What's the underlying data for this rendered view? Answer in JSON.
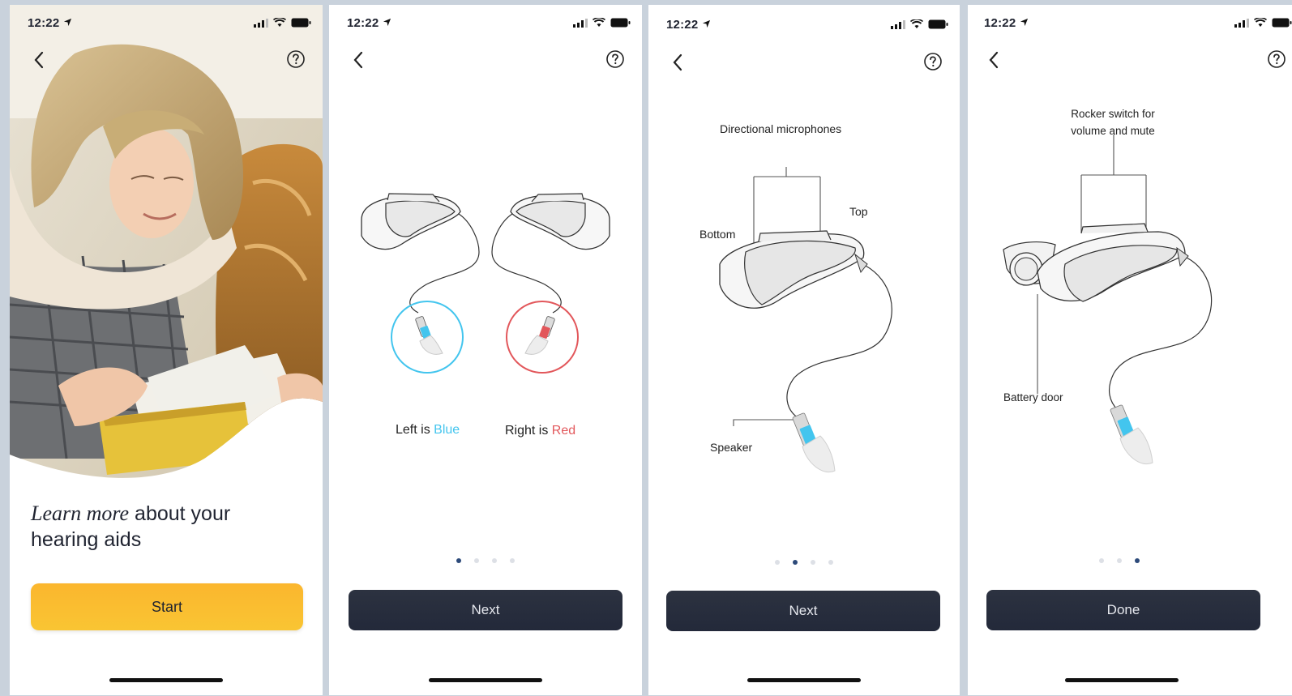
{
  "status_time": "12:22",
  "screens": [
    {
      "id": "intro",
      "heading_italic": "Learn more",
      "heading_rest": " about your hearing aids",
      "button_label": "Start"
    },
    {
      "id": "left-right",
      "left_prefix": "Left is ",
      "left_color_word": "Blue",
      "right_prefix": "Right is ",
      "right_color_word": "Red",
      "button_label": "Next",
      "page_dots": {
        "count": 4,
        "active": 1
      }
    },
    {
      "id": "parts-1",
      "labels": {
        "mics": "Directional microphones",
        "top": "Top",
        "bottom": "Bottom",
        "speaker": "Speaker"
      },
      "button_label": "Next",
      "page_dots": {
        "count": 4,
        "active": 2
      }
    },
    {
      "id": "parts-2",
      "labels": {
        "rocker_line1": "Rocker switch for",
        "rocker_line2": "volume and mute",
        "battery": "Battery door"
      },
      "button_label": "Done",
      "page_dots": {
        "count": 3,
        "active": 3
      }
    }
  ],
  "colors": {
    "left_blue": "#43c5ee",
    "right_red": "#e2575b",
    "start_button": "#fbb62e",
    "dark_button": "#272d3c",
    "active_dot": "#2d4a7a"
  },
  "icons": {
    "back": "chevron-left-icon",
    "help": "question-circle-icon",
    "location": "location-arrow-icon",
    "signal": "cellular-signal-icon",
    "wifi": "wifi-icon",
    "battery": "battery-icon"
  }
}
